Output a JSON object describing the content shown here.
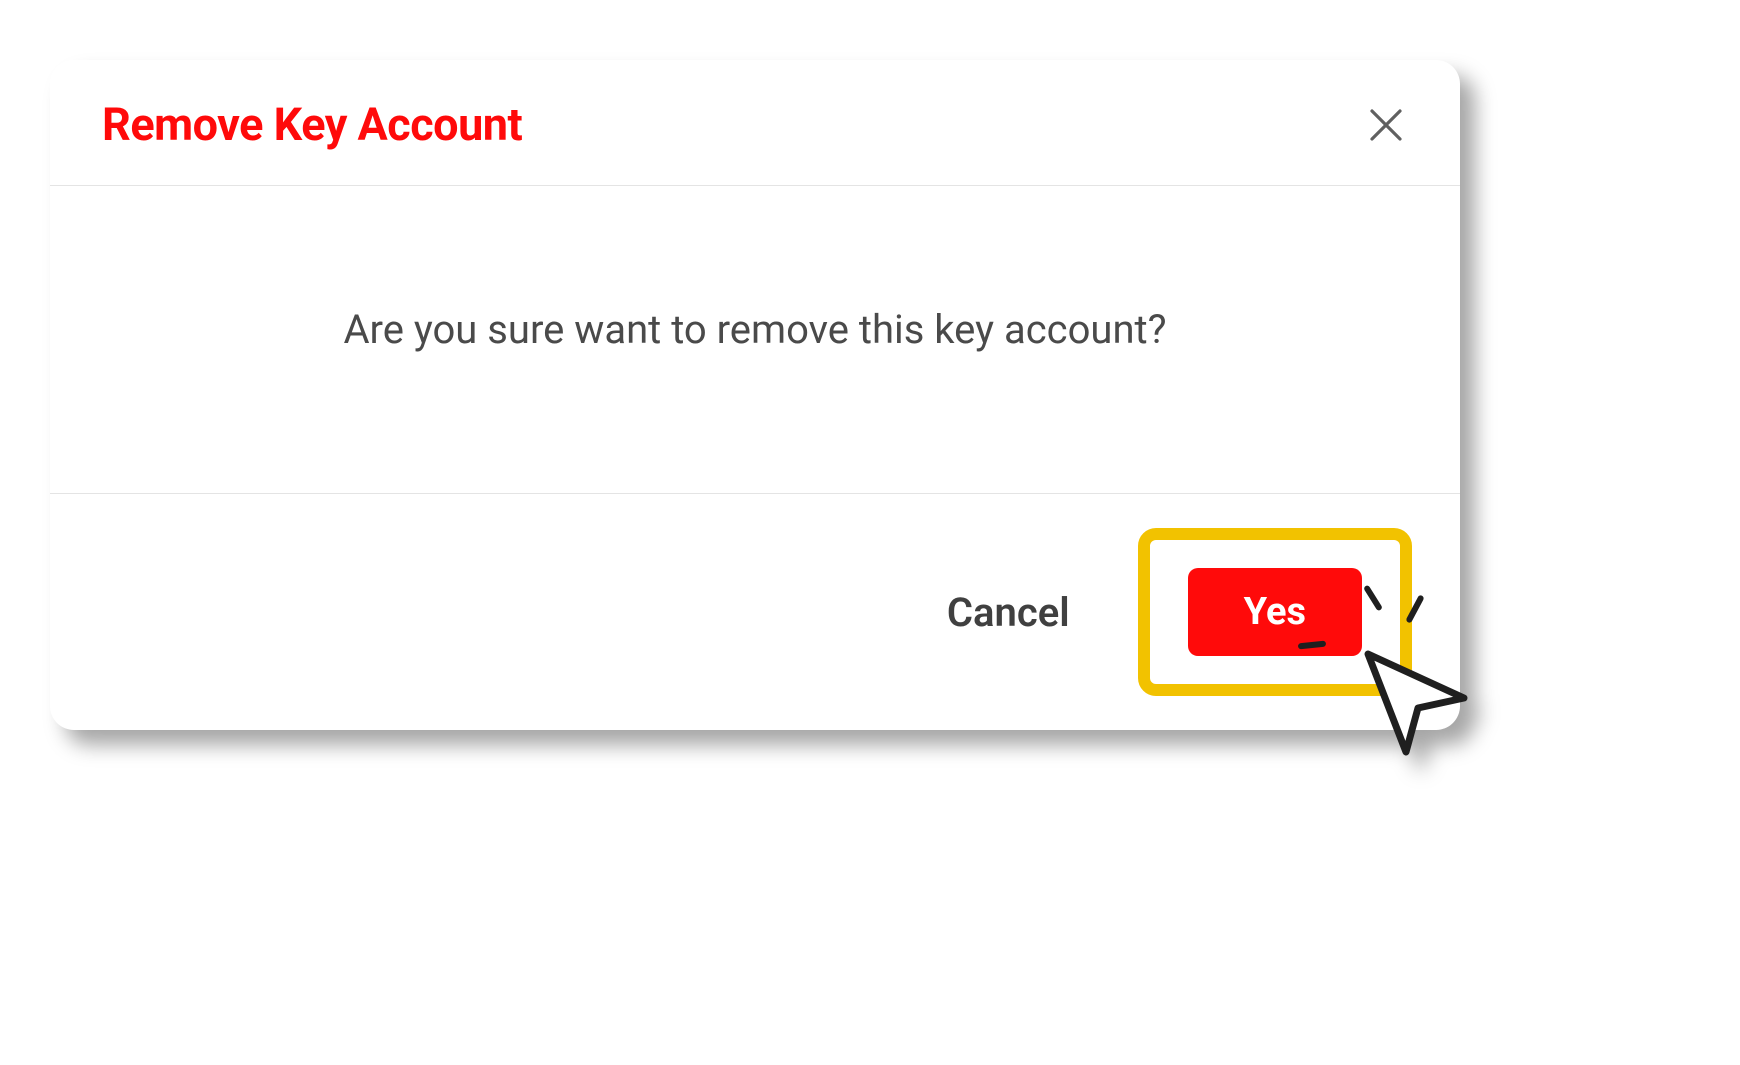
{
  "modal": {
    "title": "Remove Key Account",
    "message": "Are you sure want to remove this key account?",
    "cancel_label": "Cancel",
    "confirm_label": "Yes"
  },
  "colors": {
    "danger": "#ff0a0a",
    "highlight": "#f2c200",
    "text": "#4a4a4a"
  }
}
